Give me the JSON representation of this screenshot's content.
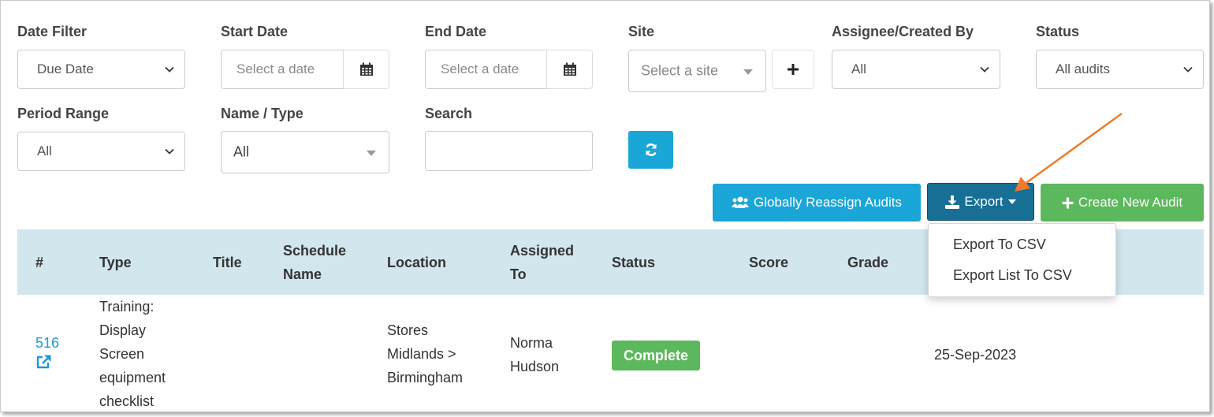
{
  "filters": {
    "date_filter": {
      "label": "Date Filter",
      "value": "Due Date"
    },
    "start_date": {
      "label": "Start Date",
      "placeholder": "Select a date"
    },
    "end_date": {
      "label": "End Date",
      "placeholder": "Select a date"
    },
    "site": {
      "label": "Site",
      "placeholder": "Select a site"
    },
    "assignee": {
      "label": "Assignee/Created By",
      "value": "All"
    },
    "status": {
      "label": "Status",
      "value": "All audits"
    },
    "period_range": {
      "label": "Period Range",
      "value": "All"
    },
    "name_type": {
      "label": "Name / Type",
      "value": "All"
    },
    "search": {
      "label": "Search",
      "value": ""
    }
  },
  "actions": {
    "reassign_label": "Globally Reassign Audits",
    "export_label": "Export",
    "create_label": "Create New Audit"
  },
  "export_menu": {
    "items": [
      "Export To CSV",
      "Export List To CSV"
    ]
  },
  "table": {
    "headers": {
      "num": "#",
      "type": "Type",
      "title": "Title",
      "schedule_1": "Schedule",
      "schedule_2": "Name",
      "location": "Location",
      "assigned_1": "Assigned",
      "assigned_2": "To",
      "status": "Status",
      "score": "Score",
      "grade": "Grade"
    },
    "rows": [
      {
        "id": "516",
        "type_lines": [
          "Training:",
          "Display",
          "Screen",
          "equipment",
          "checklist"
        ],
        "location_lines": [
          "Stores",
          "Midlands >",
          "Birmingham"
        ],
        "assigned_lines": [
          "Norma",
          "Hudson"
        ],
        "status": "Complete",
        "date": "25-Sep-2023"
      }
    ]
  },
  "colors": {
    "info": "#1aa6d6",
    "primary_dark": "#176f95",
    "success": "#5cb85c",
    "table_header": "#d2e6ee",
    "link": "#1a9ad6",
    "arrow": "#f07a2b"
  }
}
